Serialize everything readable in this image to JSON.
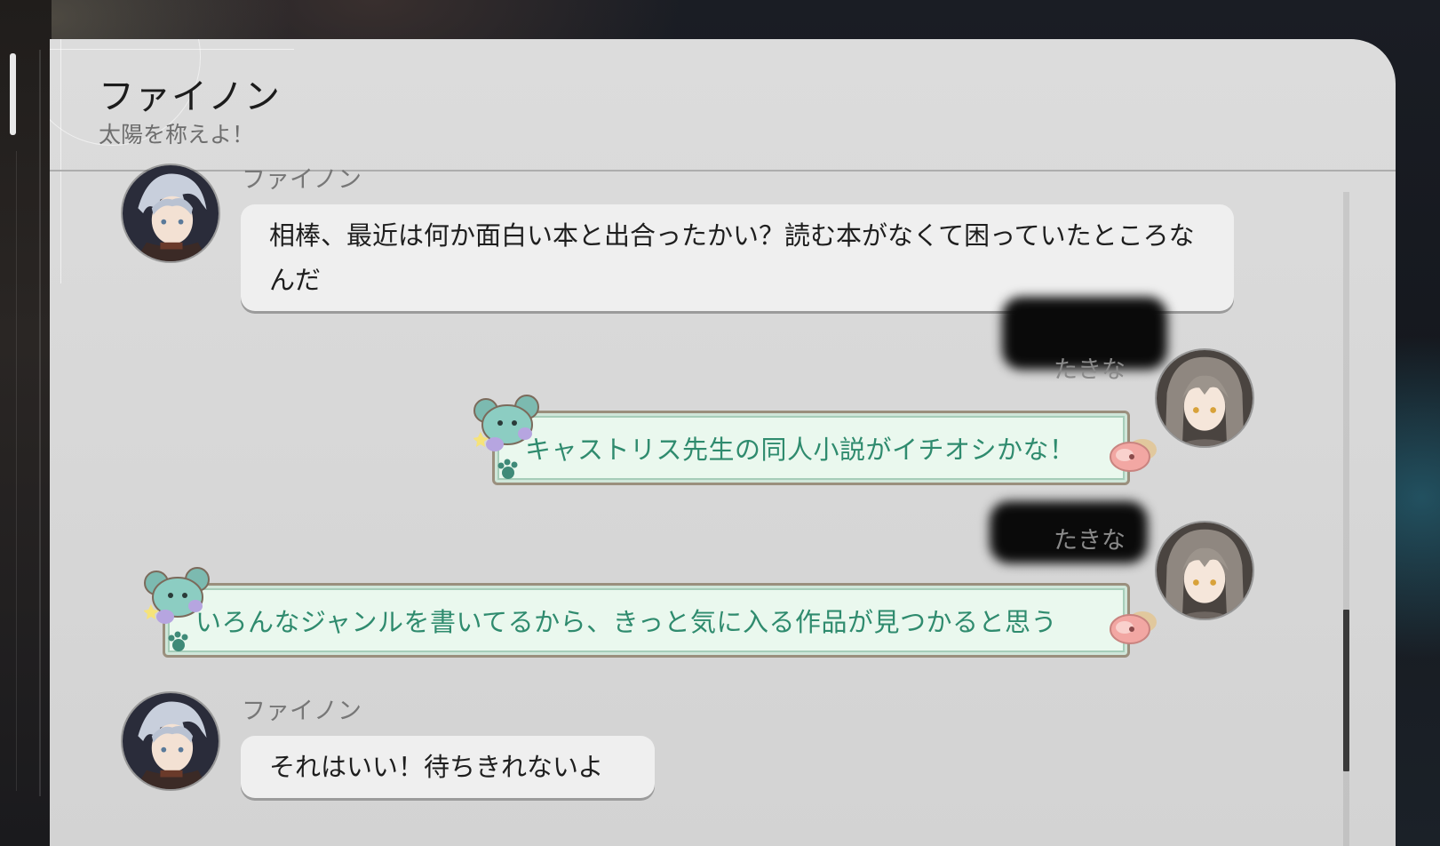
{
  "chat": {
    "title": "ファイノン",
    "subtitle": "太陽を称えよ！"
  },
  "messages": [
    {
      "sender": "ファイノン",
      "text": "相棒、最近は何か面白い本と出合ったかい？読む本がなくて困っていたところなんだ",
      "side": "left"
    },
    {
      "sender": "たきな",
      "text": "キャストリス先生の同人小説がイチオシかな！",
      "side": "right"
    },
    {
      "sender": "たきな",
      "text": "いろんなジャンルを書いてるから、きっと気に入る作品が見つかると思う",
      "side": "right"
    },
    {
      "sender": "ファイノン",
      "text": "それはいい！待ちきれないよ",
      "side": "left"
    }
  ],
  "icons": {
    "phainon_avatar": "phainon-avatar",
    "player_avatar": "player-avatar",
    "sticker_left": "mouse-sticker-icon",
    "sticker_right": "flower-sticker-icon"
  },
  "colors": {
    "panel": "#d8d8d8",
    "bubble_gray": "#efefef",
    "bubble_green": "#eaf8ee",
    "green_text": "#2f8b6e"
  }
}
